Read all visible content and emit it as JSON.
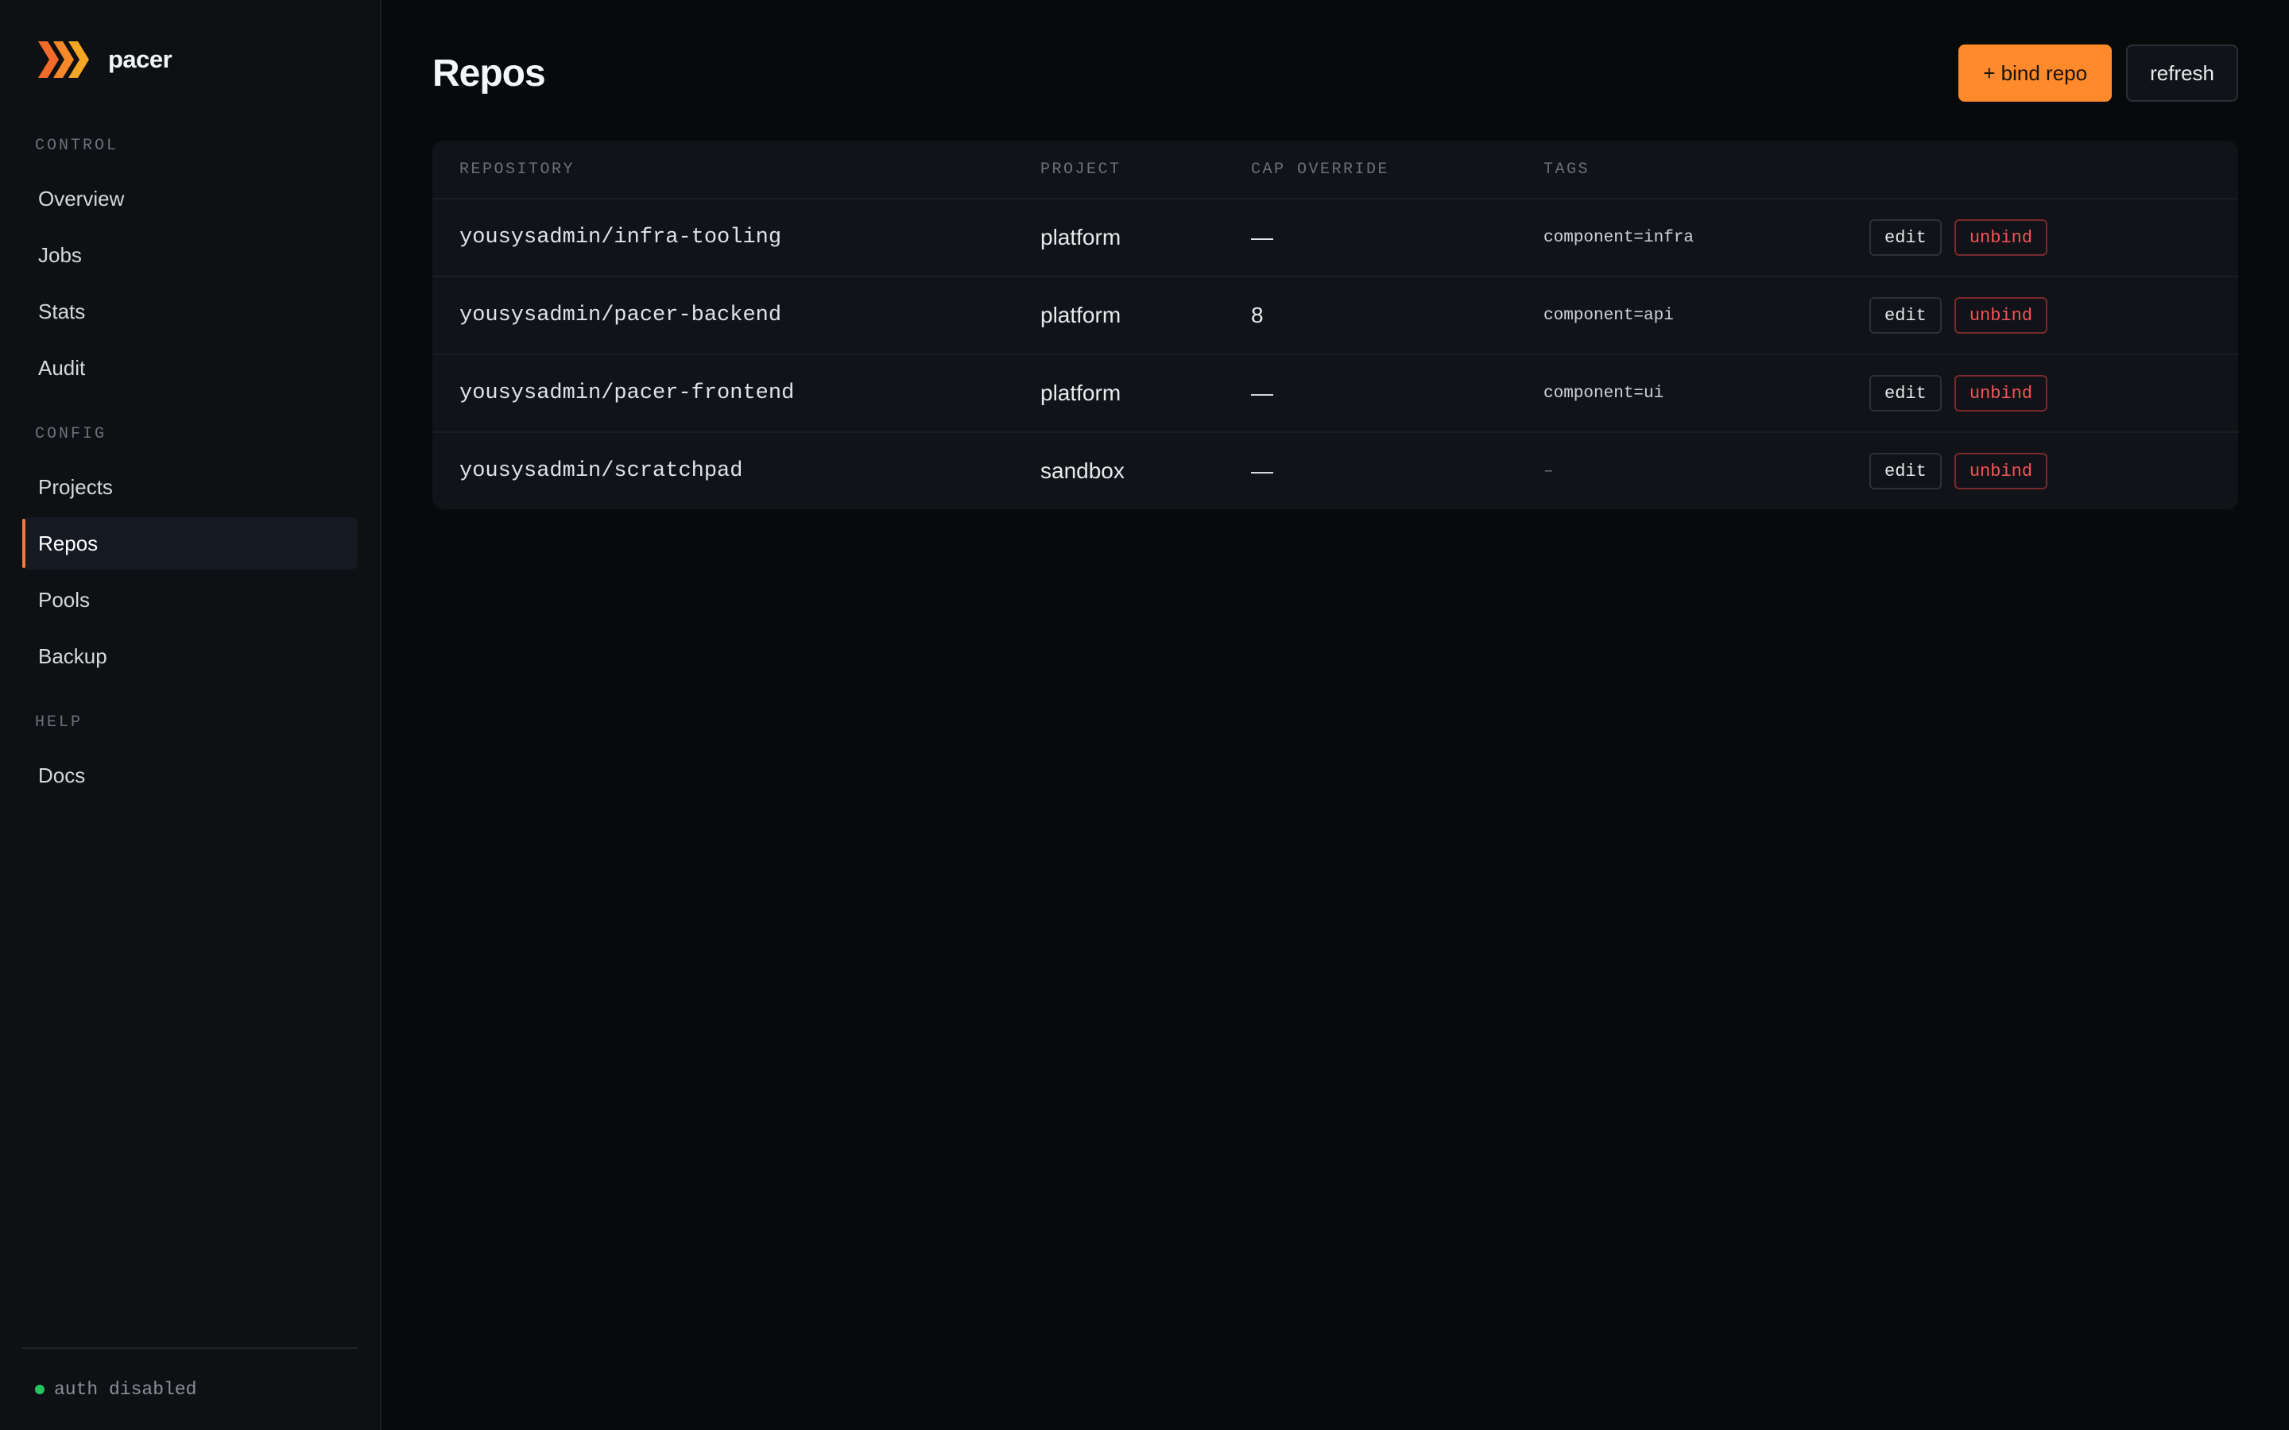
{
  "brand": {
    "name": "pacer",
    "logo_colors": [
      "#f26b2a",
      "#f5a623"
    ]
  },
  "sidebar": {
    "sections": [
      {
        "label": "CONTROL",
        "items": [
          "Overview",
          "Jobs",
          "Stats",
          "Audit"
        ]
      },
      {
        "label": "CONFIG",
        "items": [
          "Projects",
          "Repos",
          "Pools",
          "Backup"
        ]
      },
      {
        "label": "HELP",
        "items": [
          "Docs"
        ]
      }
    ],
    "active_item": "Repos",
    "footer_status": "auth disabled",
    "status_color": "#22c55e"
  },
  "page": {
    "title": "Repos",
    "bind_label": "+ bind repo",
    "refresh_label": "refresh"
  },
  "table": {
    "headers": [
      "REPOSITORY",
      "PROJECT",
      "CAP OVERRIDE",
      "TAGS"
    ],
    "rows": [
      {
        "repository": "yousysadmin/infra-tooling",
        "project": "platform",
        "cap": "—",
        "tags": "component=infra",
        "edit": "edit",
        "unbind": "unbind"
      },
      {
        "repository": "yousysadmin/pacer-backend",
        "project": "platform",
        "cap": "8",
        "tags": "component=api",
        "edit": "edit",
        "unbind": "unbind"
      },
      {
        "repository": "yousysadmin/pacer-frontend",
        "project": "platform",
        "cap": "—",
        "tags": "component=ui",
        "edit": "edit",
        "unbind": "unbind"
      },
      {
        "repository": "yousysadmin/scratchpad",
        "project": "sandbox",
        "cap": "—",
        "tags": "–",
        "edit": "edit",
        "unbind": "unbind"
      }
    ]
  },
  "colors": {
    "accent": "#ff8a2b",
    "danger": "#f25555",
    "active_indicator": "#f27a3a"
  }
}
